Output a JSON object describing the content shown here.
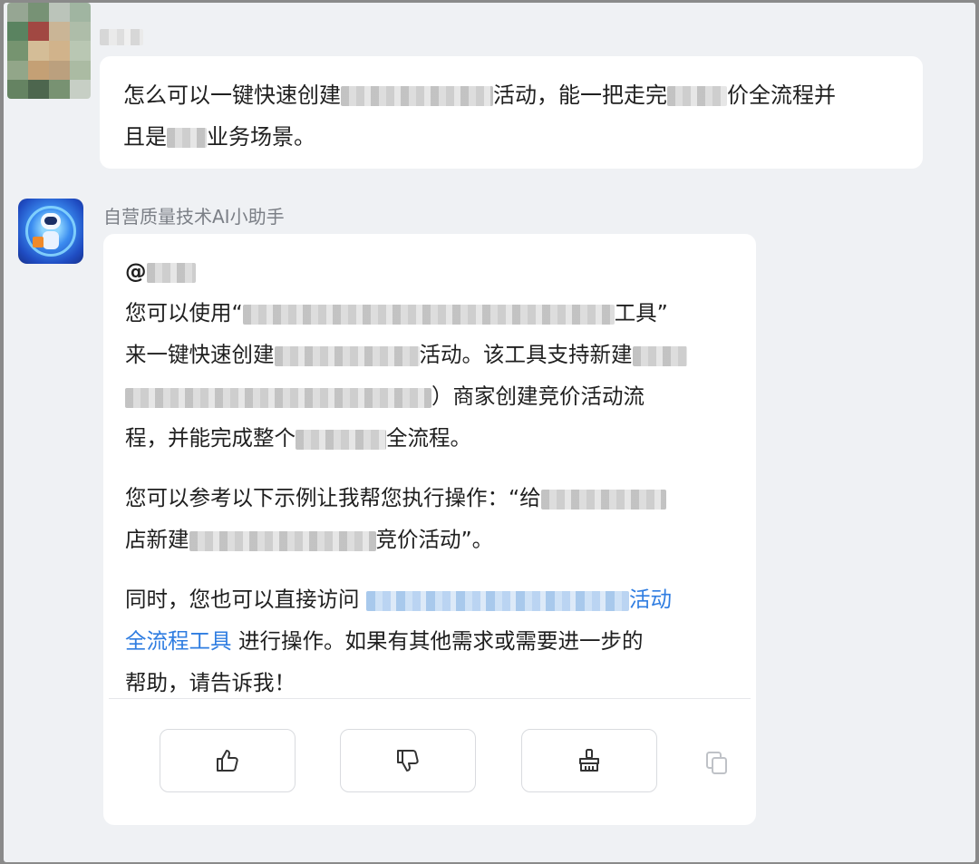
{
  "user_message": {
    "seg1": "怎么可以一键快速创建",
    "seg2": "活动，能一把走完",
    "seg3": "价全流程并",
    "seg4": "且是",
    "seg5": "业务场景。"
  },
  "bot": {
    "name": "自营质量技术AI小助手",
    "mention_prefix": "@",
    "p1": {
      "a": "您可以使用“",
      "b": "工具”",
      "c": "来一键快速创建",
      "d": "活动。该工具支持新建",
      "e": "）商家创建竞价活动流",
      "f": "程，并能完成整个",
      "g": "全流程。"
    },
    "p2": {
      "a": "您可以参考以下示例让我帮您执行操作：“给",
      "b": "店新建",
      "c": "竞价活动”。"
    },
    "p3": {
      "a": "同时，您也可以直接访问",
      "link_visible": "活动",
      "link_line2": "全流程工具",
      "b": "进行操作。如果有其他需求或需要进一步的",
      "c": "帮助，请告诉我！"
    }
  },
  "actions": {
    "like_icon": "thumbs-up-icon",
    "dislike_icon": "thumbs-down-icon",
    "clear_icon": "brush-icon",
    "copy_icon": "copy-icon"
  },
  "colors": {
    "background": "#eff1f4",
    "bubble": "#ffffff",
    "link": "#2f7de1",
    "muted_text": "#7b7f86"
  }
}
